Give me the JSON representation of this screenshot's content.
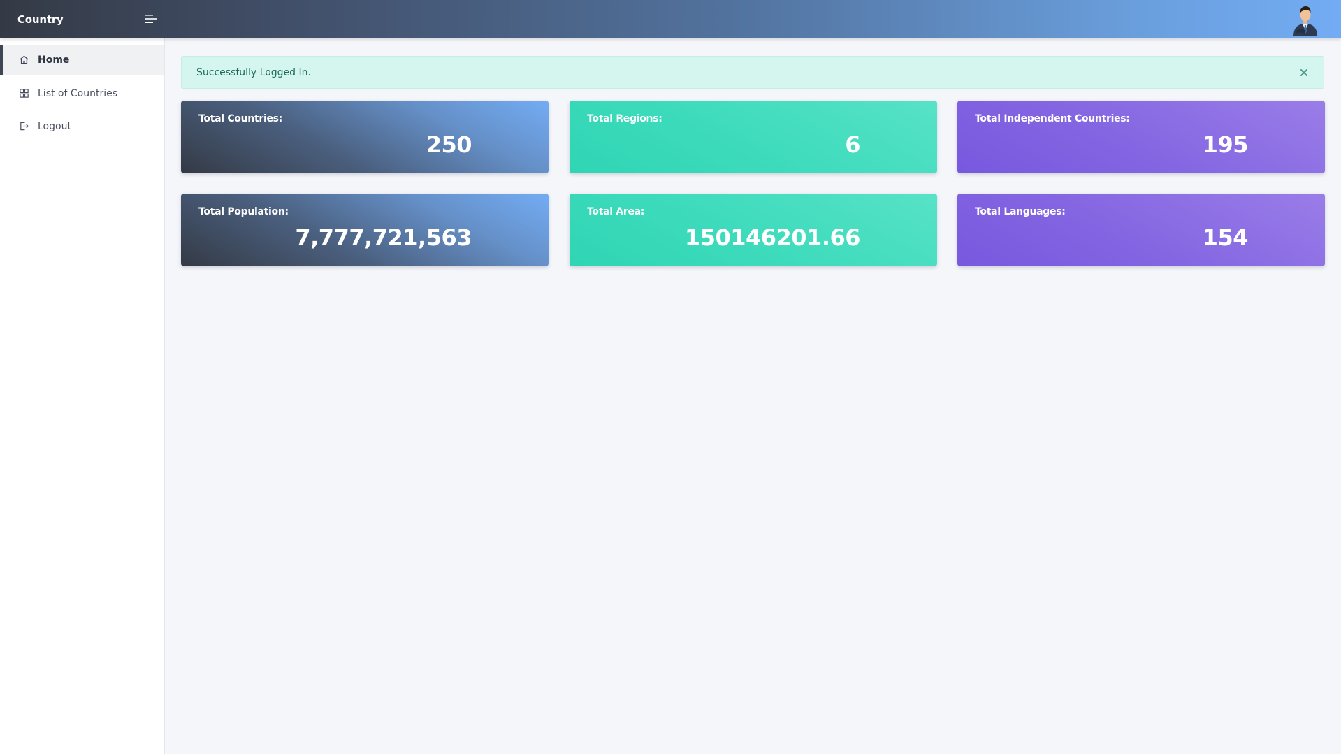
{
  "header": {
    "brand": "Country",
    "menu_icon": "menu-toggle-icon",
    "avatar_icon": "user-avatar"
  },
  "sidebar": {
    "items": [
      {
        "label": "Home",
        "icon": "home-icon",
        "active": true
      },
      {
        "label": "List of Countries",
        "icon": "grid-icon",
        "active": false
      },
      {
        "label": "Logout",
        "icon": "logout-icon",
        "active": false
      }
    ]
  },
  "alert": {
    "message": "Successfully Logged In.",
    "close_icon": "close-icon"
  },
  "stats": [
    {
      "label": "Total Countries:",
      "value": "250",
      "theme": "dark"
    },
    {
      "label": "Total Regions:",
      "value": "6",
      "theme": "teal"
    },
    {
      "label": "Total Independent Countries:",
      "value": "195",
      "theme": "purple"
    },
    {
      "label": "Total Population:",
      "value": "7,777,721,563",
      "theme": "dark"
    },
    {
      "label": "Total Area:",
      "value": "150146201.66",
      "theme": "teal"
    },
    {
      "label": "Total Languages:",
      "value": "154",
      "theme": "purple"
    }
  ],
  "colors": {
    "accent_dark": "#343a45",
    "accent_blue": "#73acf4",
    "accent_teal": "#2fd5b4",
    "accent_purple": "#7858de",
    "alert_bg": "#d4f6ee"
  }
}
